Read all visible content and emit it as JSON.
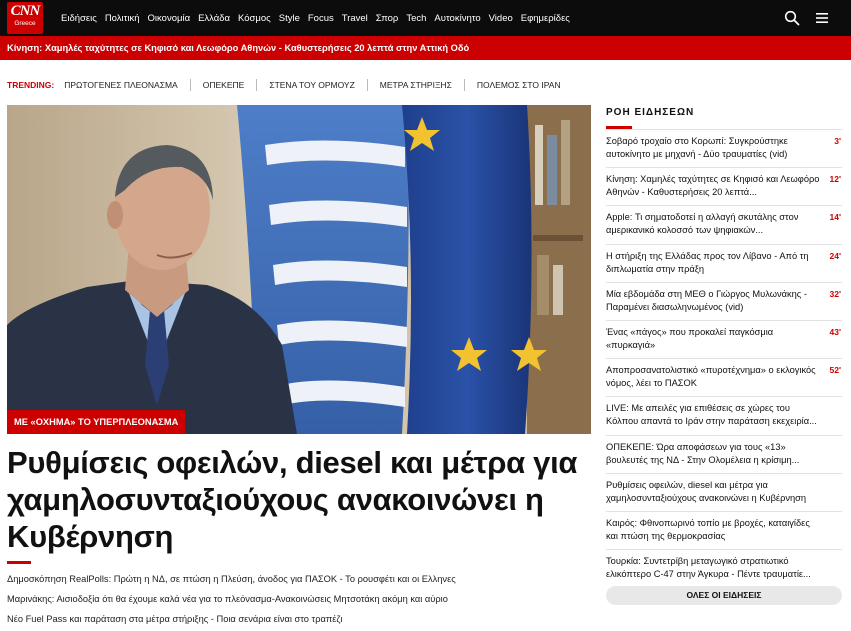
{
  "logo": {
    "line1": "CNN",
    "line2": "Greece"
  },
  "nav": [
    "Ειδήσεις",
    "Πολιτική",
    "Οικονομία",
    "Ελλάδα",
    "Κόσμος",
    "Style",
    "Focus",
    "Travel",
    "Σπορ",
    "Tech",
    "Αυτοκίνητο",
    "Video",
    "Εφημερίδες"
  ],
  "breaking": "Κίνηση: Χαμηλές ταχύτητες σε Κηφισό και Λεωφόρο Αθηνών - Καθυστερήσεις 20 λεπτά στην Αττική Οδό",
  "trending": {
    "label": "TRENDING:",
    "items": [
      "ΠΡΩΤΟΓΕΝΕΣ ΠΛΕΟΝΑΣΜΑ",
      "ΟΠΕΚΕΠΕ",
      "ΣΤΕΝΑ ΤΟΥ ΟΡΜΟΥΖ",
      "ΜΕΤΡΑ ΣΤΗΡΙΞΗΣ",
      "ΠΟΛΕΜΟΣ ΣΤΟ ΙΡΑΝ"
    ]
  },
  "hero": {
    "kicker": "ΜΕ «ΟΧΗΜΑ» ΤΟ ΥΠΕΡΠΛΕΟΝΑΣΜΑ",
    "headline": "Ρυθμίσεις οφειλών, diesel και μέτρα για χαμηλοσυνταξιούχους ανακοινώνει η Κυβέρνηση"
  },
  "related": [
    "Δημοσκόπηση RealPolls: Πρώτη η ΝΔ, σε πτώση η Πλεύση, άνοδος για ΠΑΣΟΚ - Το ρουσφέτι και οι Ελληνες",
    "Μαρινάκης: Αισιοδοξία ότι θα έχουμε καλά νέα για το πλεόνασμα-Ανακοινώσεις Μητσοτάκη ακόμη και αύριο",
    "Νέο Fuel Pass και παράταση στα μέτρα στήριξης - Ποια σενάρια είναι στο τραπέζι"
  ],
  "feed": {
    "title": "ΡΟΗ ΕΙΔΗΣΕΩΝ",
    "items": [
      {
        "text": "Σοβαρό τροχαίο στο Κορωπί: Συγκρούστηκε αυτοκίνητο με μηχανή - Δύο τραυματίες (vid)",
        "time": "3'"
      },
      {
        "text": "Κίνηση: Χαμηλές ταχύτητες σε Κηφισό και Λεωφόρο Αθηνών - Καθυστερήσεις 20 λεπτά...",
        "time": "12'"
      },
      {
        "text": "Apple: Τι σηματοδοτεί η αλλαγή σκυτάλης στον αμερικανικό κολοσσό των ψηφιακών...",
        "time": "14'"
      },
      {
        "text": "Η στήριξη της Ελλάδας προς τον Λίβανο - Από τη διπλωματία στην πράξη",
        "time": "24'"
      },
      {
        "text": "Μία εβδομάδα στη ΜΕΘ ο Γιώργος Μυλωνάκης - Παραμένει διασωληνωμένος (vid)",
        "time": "32'"
      },
      {
        "text": "Ένας «πάγος» που προκαλεί παγκόσμια «πυρκαγιά»",
        "time": "43'"
      },
      {
        "text": "Αποπροσανατολιστικό «πυροτέχνημα» ο εκλογικός νόμος, λέει το ΠΑΣΟΚ",
        "time": "52'"
      },
      {
        "text": "LIVE: Με απειλές για επιθέσεις σε χώρες του Κόλπου απαντά το Ιράν στην παράταση εκεχειρία...",
        "time": ""
      },
      {
        "text": "ΟΠΕΚΕΠΕ: Ώρα αποφάσεων για τους «13» βουλευτές της ΝΔ - Στην Ολομέλεια η κρίσιμη...",
        "time": ""
      },
      {
        "text": "Ρυθμίσεις οφειλών, diesel και μέτρα για χαμηλοσυνταξιούχους ανακοινώνει η Κυβέρνηση",
        "time": ""
      },
      {
        "text": "Καιρός: Φθινοπωρινό τοπίο με βροχές, καταιγίδες και πτώση της θερμοκρασίας",
        "time": ""
      },
      {
        "text": "Τουρκία: Συντετρίβη μεταγωγικό στρατιωτικό ελικόπτερο C-47 στην Άγκυρα - Πέντε τραυματίε...",
        "time": ""
      }
    ],
    "all_label": "ΟΛΕΣ ΟΙ ΕΙΔΗΣΕΙΣ"
  }
}
